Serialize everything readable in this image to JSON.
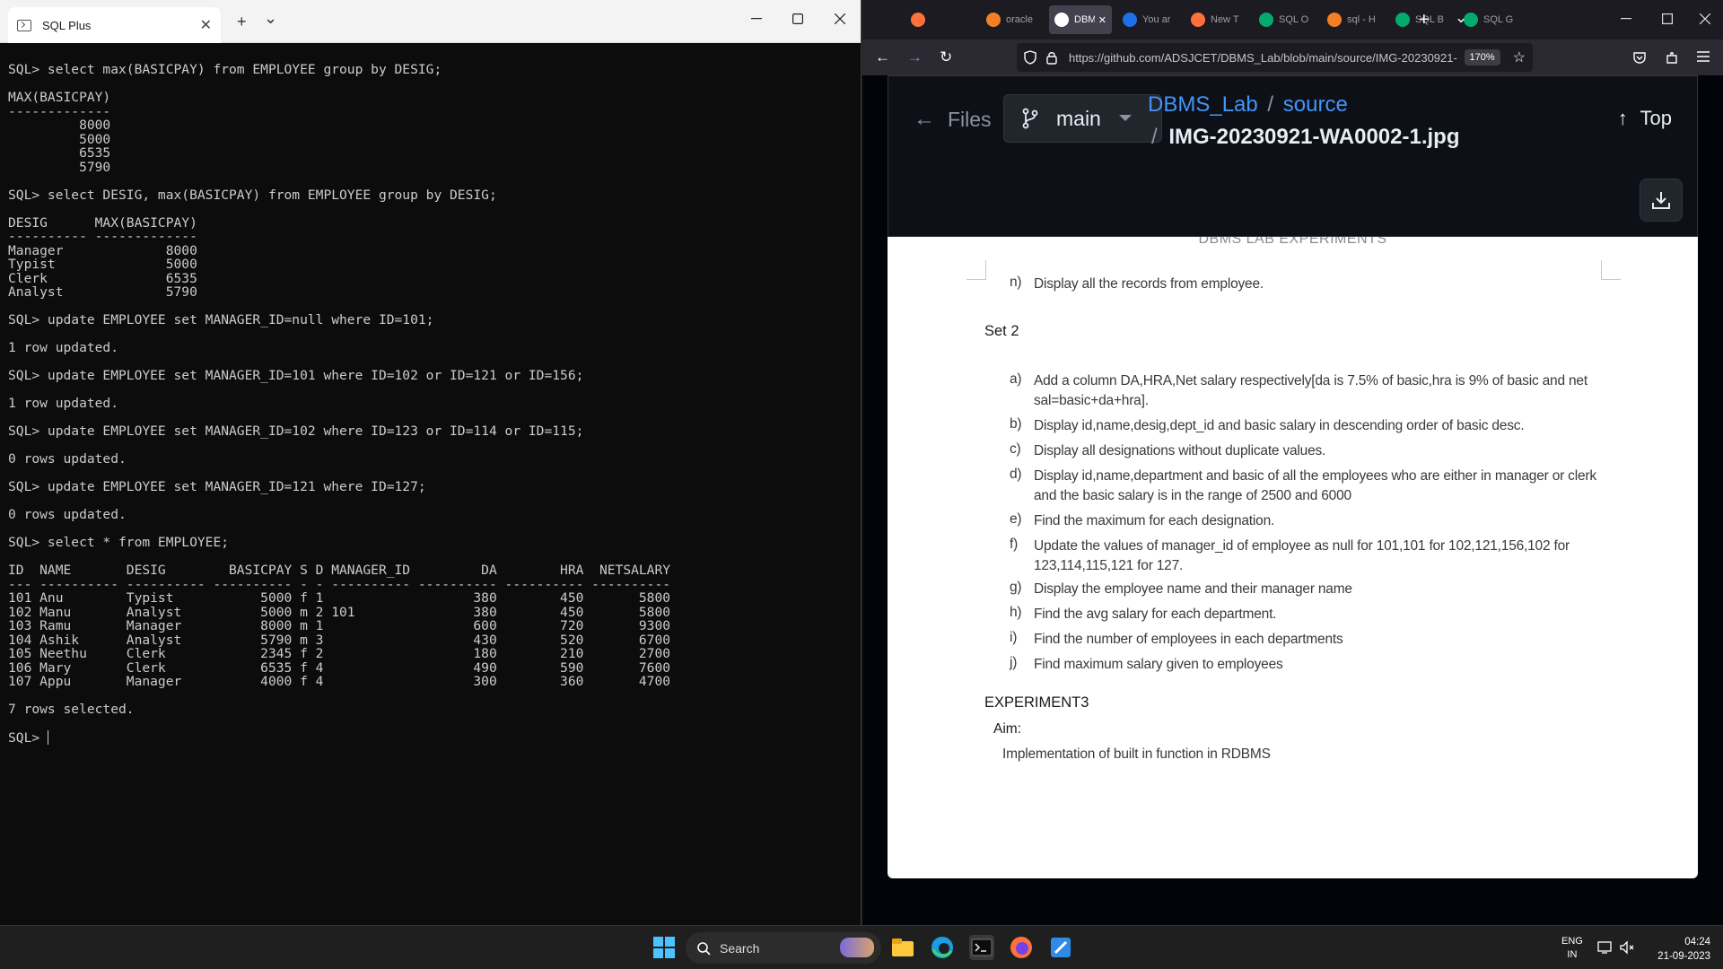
{
  "terminal": {
    "tab_title": "SQL Plus",
    "tab_close": "✕",
    "new_tab": "+",
    "dropdown": "⌄",
    "lines": [
      "SQL> select max(BASICPAY) from EMPLOYEE group by DESIG;",
      "",
      "MAX(BASICPAY)",
      "-------------",
      "         8000",
      "         5000",
      "         6535",
      "         5790",
      "",
      "SQL> select DESIG, max(BASICPAY) from EMPLOYEE group by DESIG;",
      "",
      "DESIG      MAX(BASICPAY)",
      "---------- -------------",
      "Manager             8000",
      "Typist              5000",
      "Clerk               6535",
      "Analyst             5790",
      "",
      "SQL> update EMPLOYEE set MANAGER_ID=null where ID=101;",
      "",
      "1 row updated.",
      "",
      "SQL> update EMPLOYEE set MANAGER_ID=101 where ID=102 or ID=121 or ID=156;",
      "",
      "1 row updated.",
      "",
      "SQL> update EMPLOYEE set MANAGER_ID=102 where ID=123 or ID=114 or ID=115;",
      "",
      "0 rows updated.",
      "",
      "SQL> update EMPLOYEE set MANAGER_ID=121 where ID=127;",
      "",
      "0 rows updated.",
      "",
      "SQL> select * from EMPLOYEE;",
      "",
      "ID  NAME       DESIG        BASICPAY S D MANAGER_ID         DA        HRA  NETSALARY",
      "--- ---------- ---------- ---------- - - ---------- ---------- ---------- ----------",
      "101 Anu        Typist           5000 f 1                   380        450       5800",
      "102 Manu       Analyst          5000 m 2 101               380        450       5800",
      "103 Ramu       Manager          8000 m 1                   600        720       9300",
      "104 Ashik      Analyst          5790 m 3                   430        520       6700",
      "105 Neethu     Clerk            2345 f 2                   180        210       2700",
      "106 Mary       Clerk            6535 f 4                   490        590       7600",
      "107 Appu       Manager          4000 f 4                   300        360       4700",
      "",
      "7 rows selected.",
      "",
      "SQL> "
    ]
  },
  "browser": {
    "tabs": [
      {
        "label": "",
        "icon": "firefox-icon",
        "color": "#ff7139"
      },
      {
        "label": "oracle",
        "icon": "stackoverflow-icon",
        "color": "#f48024"
      },
      {
        "label": "DBM",
        "icon": "github-icon",
        "color": "#ffffff"
      },
      {
        "label": "You ar",
        "icon": "s-icon",
        "color": "#1f6feb"
      },
      {
        "label": "New T",
        "icon": "firefox-icon",
        "color": "#ff7139"
      },
      {
        "label": "SQL O",
        "icon": "w3-icon",
        "color": "#04aa6d"
      },
      {
        "label": "sql - H",
        "icon": "stackoverflow-icon",
        "color": "#f48024"
      },
      {
        "label": "SQL B",
        "icon": "w3-icon",
        "color": "#04aa6d"
      },
      {
        "label": "SQL G",
        "icon": "w3-icon",
        "color": "#04aa6d"
      }
    ],
    "url": "https://github.com/ADSJCET/DBMS_Lab/blob/main/source/IMG-20230921-",
    "zoom": "170%"
  },
  "github": {
    "files_label": "Files",
    "branch": "main",
    "repo": "DBMS_Lab",
    "dir": "source",
    "file": "IMG-20230921-WA0002-1.jpg",
    "sep": "/",
    "top_label": "Top"
  },
  "document": {
    "header": "DBMS LAB EXPERIMENTS",
    "item_n": {
      "letter": "n)",
      "text": "Display all the records from employee."
    },
    "set_title": "Set 2",
    "items": [
      {
        "letter": "a)",
        "text": "Add a column DA,HRA,Net salary respectively[da is 7.5% of basic,hra is 9% of basic and net sal=basic+da+hra]."
      },
      {
        "letter": "b)",
        "text": "Display id,name,desig,dept_id and basic salary in descending order of basic desc."
      },
      {
        "letter": "c)",
        "text": "Display all designations without duplicate values."
      },
      {
        "letter": "d)",
        "text": "Display id,name,department and basic of all the employees who are either in manager or clerk and the basic salary is in the range of 2500 and 6000"
      },
      {
        "letter": "e)",
        "text": "Find the maximum for each designation."
      },
      {
        "letter": "f)",
        "text": "Update the values of manager_id of employee as null for 101,101 for 102,121,156,102 for 123,114,115,121 for 127."
      },
      {
        "letter": "g)",
        "text": "Display the employee name and their manager name"
      },
      {
        "letter": "h)",
        "text": "Find the avg salary for each department."
      },
      {
        "letter": "i)",
        "text": "Find the number of employees in each departments"
      },
      {
        "letter": "j)",
        "text": "Find maximum salary given to employees"
      }
    ],
    "experiment": "EXPERIMENT3",
    "aim_label": "Aim:",
    "aim_text": "Implementation of built in function in RDBMS"
  },
  "taskbar": {
    "search": "Search",
    "lang_top": "ENG",
    "lang_bottom": "IN",
    "time": "04:24",
    "date": "21-09-2023"
  }
}
